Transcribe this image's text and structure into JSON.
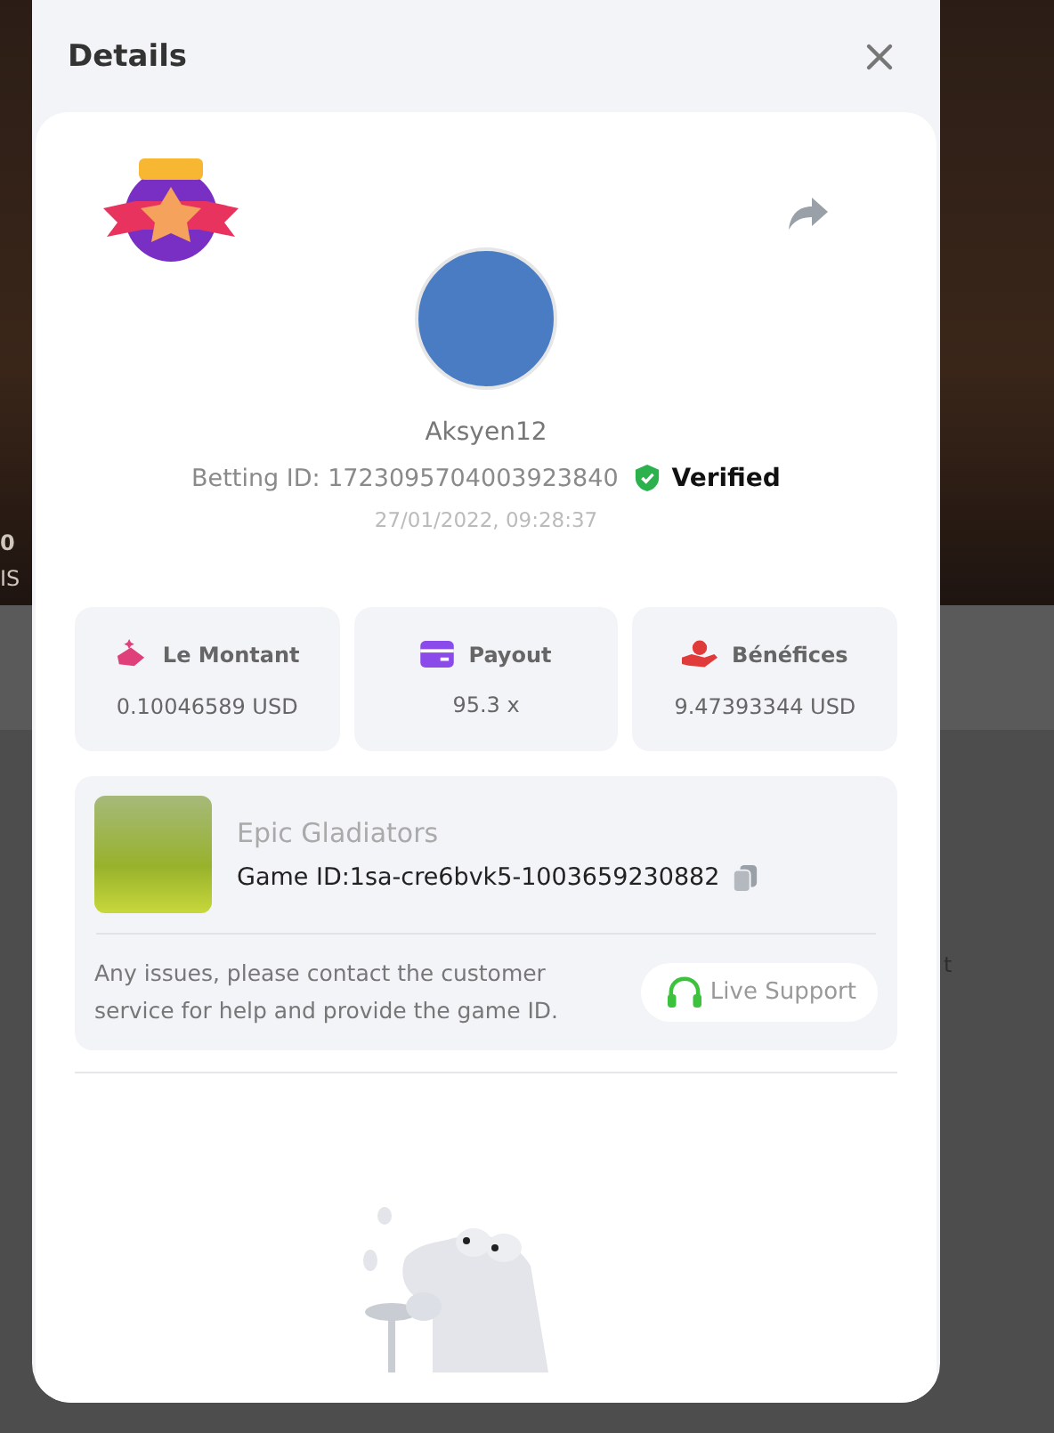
{
  "background": {
    "fragments": [
      "0",
      "IS",
      "t"
    ]
  },
  "dialog": {
    "title": "Details",
    "user": {
      "name": "Aksyen12",
      "betting_id": "Betting ID: 1723095704003923840",
      "status": "Verified",
      "date": "27/01/2022, 09:28:37"
    },
    "stats": [
      {
        "kind": "amount",
        "label": "Le Montant",
        "value": "0.10046589 USD"
      },
      {
        "kind": "payout",
        "label": "Payout",
        "value": "95.3 x"
      },
      {
        "kind": "profit",
        "label": "Bénéfices",
        "value": "9.47393344 USD"
      }
    ],
    "game": {
      "name": "Epic Gladiators",
      "game_id": "Game ID:1sa-cre6bvk5-1003659230882",
      "notice": "Any issues, please contact the customer service for help and provide the game ID.",
      "support_button": "Live Support"
    }
  }
}
